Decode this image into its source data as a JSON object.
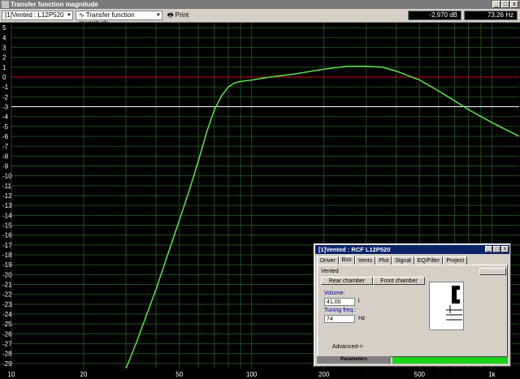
{
  "window": {
    "title": "Transfer function magnitude"
  },
  "toolbar": {
    "driver_select": "[1]Vented : L12P520",
    "view_select": "Transfer function magnitude",
    "print_label": "Print",
    "readout_db": "-2,970 dB",
    "readout_hz": "73,26 Hz"
  },
  "chart_data": {
    "type": "line",
    "xscale": "log",
    "xlim": [
      10,
      1300
    ],
    "ylim": [
      -29.5,
      5.5
    ],
    "xlabel": "",
    "ylabel": "",
    "x_ticks": [
      "10",
      "20",
      "50",
      "100",
      "200",
      "500",
      "1k"
    ],
    "y_ticks": [
      "5",
      "4",
      "3",
      "2",
      "1",
      "0",
      "-1",
      "-2",
      "-3",
      "-4",
      "-5",
      "-6",
      "-7",
      "-8",
      "-9",
      "-10",
      "-11",
      "-12",
      "-13",
      "-14",
      "-15",
      "-16",
      "-17",
      "-18",
      "-19",
      "-20",
      "-21",
      "-22",
      "-23",
      "-24",
      "-25",
      "-26",
      "-27",
      "-28",
      "-29"
    ],
    "reference_lines": [
      {
        "y": 0,
        "color": "#c81414"
      },
      {
        "y": -3,
        "color": "#ffffff"
      }
    ],
    "grid": true,
    "series": [
      {
        "color": "#5ee04e",
        "x": [
          30,
          33,
          36,
          40,
          45,
          50,
          55,
          60,
          65,
          70,
          75,
          80,
          85,
          90,
          100,
          120,
          150,
          200,
          250,
          300,
          350,
          400,
          500,
          600,
          700,
          800,
          1000,
          1300
        ],
        "y": [
          -29.5,
          -27.0,
          -24.5,
          -21.5,
          -17.8,
          -14.5,
          -11.5,
          -8.5,
          -5.6,
          -3.3,
          -1.9,
          -1.0,
          -0.6,
          -0.45,
          -0.3,
          0.0,
          0.3,
          0.8,
          1.1,
          1.1,
          1.0,
          0.6,
          -0.3,
          -1.4,
          -2.4,
          -3.3,
          -4.6,
          -6.0
        ]
      }
    ]
  },
  "dialog": {
    "title": "[1]Vented : RCF L12P520",
    "tabs": [
      "Driver",
      "Box",
      "Vents",
      "Plot",
      "Signal",
      "EQ/Filter",
      "Project"
    ],
    "box_type": "Vented",
    "rear_chamber": "Rear chamber",
    "front_chamber": "Front chamber",
    "volume_label": "Volume:",
    "volume_value": "41,00",
    "volume_unit": "l",
    "tuning_label": "Tuning freq.:",
    "tuning_value": "74",
    "tuning_unit": "Hz",
    "advanced": "Advanced->",
    "status": "Parameters"
  }
}
